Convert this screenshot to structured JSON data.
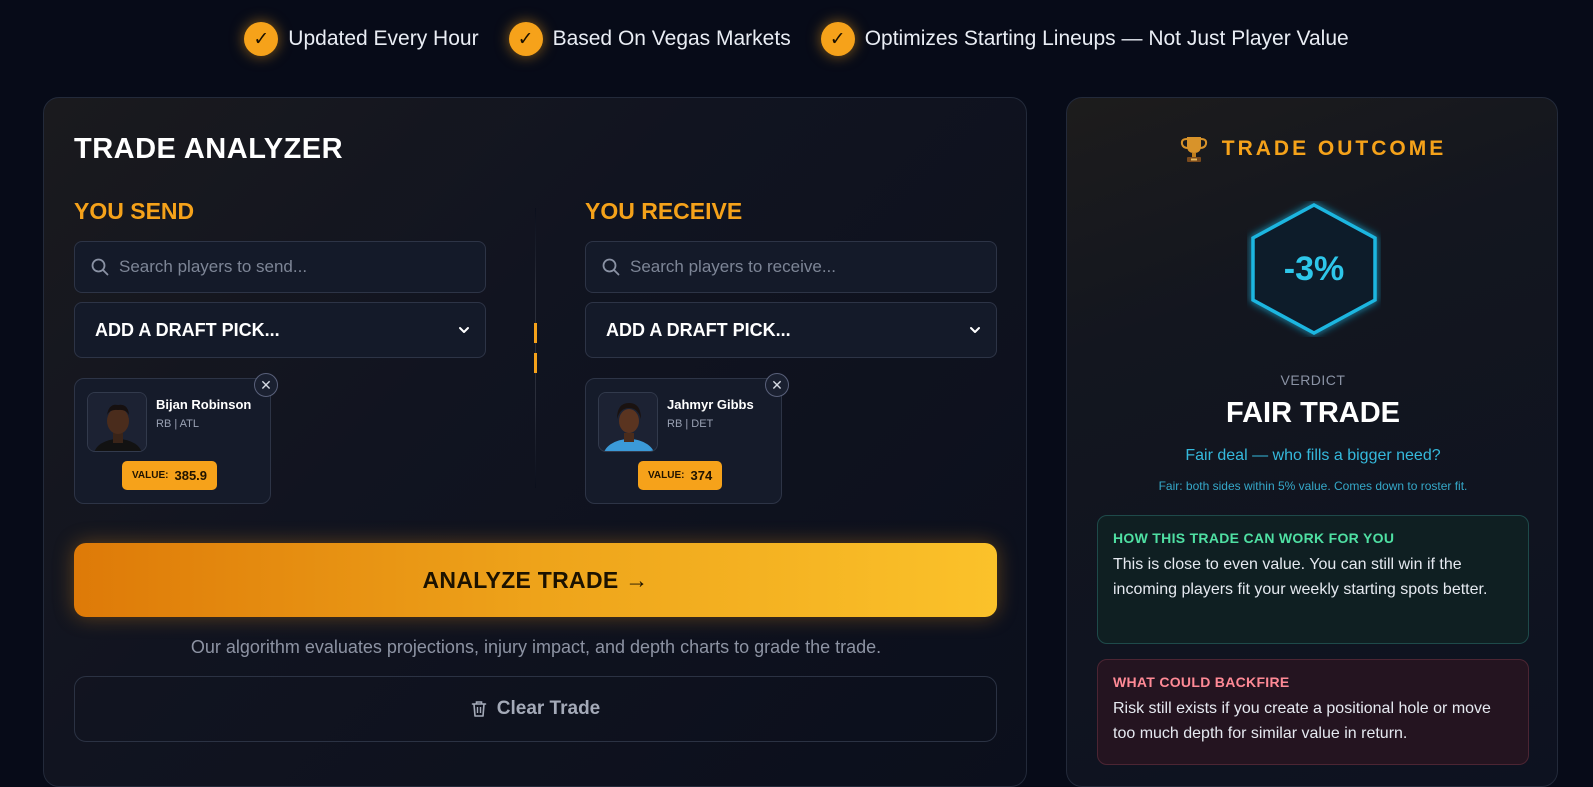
{
  "badges": [
    {
      "icon": "check-icon",
      "label": "Updated Every Hour"
    },
    {
      "icon": "check-icon",
      "label": "Based On Vegas Markets"
    },
    {
      "icon": "check-icon",
      "label": "Optimizes Starting Lineups — Not Just Player Value"
    }
  ],
  "analyzer": {
    "title": "TRADE ANALYZER",
    "send": {
      "heading": "YOU SEND",
      "search_placeholder": "Search players to send...",
      "draft_pick_selected": "ADD A DRAFT PICK...",
      "player": {
        "name": "Bijan Robinson",
        "position": "RB | ATL",
        "value_label": "VALUE:",
        "value": "385.9"
      }
    },
    "receive": {
      "heading": "YOU RECEIVE",
      "search_placeholder": "Search players to receive...",
      "draft_pick_selected": "ADD A DRAFT PICK...",
      "player": {
        "name": "Jahmyr Gibbs",
        "position": "RB | DET",
        "value_label": "VALUE:",
        "value": "374"
      }
    },
    "analyze_label": "ANALYZE TRADE →",
    "note": "Our algorithm evaluates projections, injury impact, and depth charts to grade the trade.",
    "clear_label": "Clear Trade"
  },
  "outcome": {
    "icon": "trophy-icon",
    "title": "TRADE OUTCOME",
    "percent": "-3%",
    "verdict_label": "VERDICT",
    "verdict": "FAIR TRADE",
    "subtitle": "Fair deal — who fills a bigger need?",
    "note": "Fair: both sides within 5% value. Comes down to roster fit.",
    "work_heading": "HOW THIS TRADE CAN WORK FOR YOU",
    "work_body": "This is close to even value. You can still win if the incoming players fit your weekly starting spots better.",
    "backfire_heading": "WHAT COULD BACKFIRE",
    "backfire_body": "Risk still exists if you create a positional hole or move too much depth for similar value in return."
  },
  "colors": {
    "background": "#070b18",
    "accent": "#f5a21a",
    "cyan": "#2ec7ea",
    "positive": "#4fe0a3",
    "negative": "#ff8a96"
  }
}
